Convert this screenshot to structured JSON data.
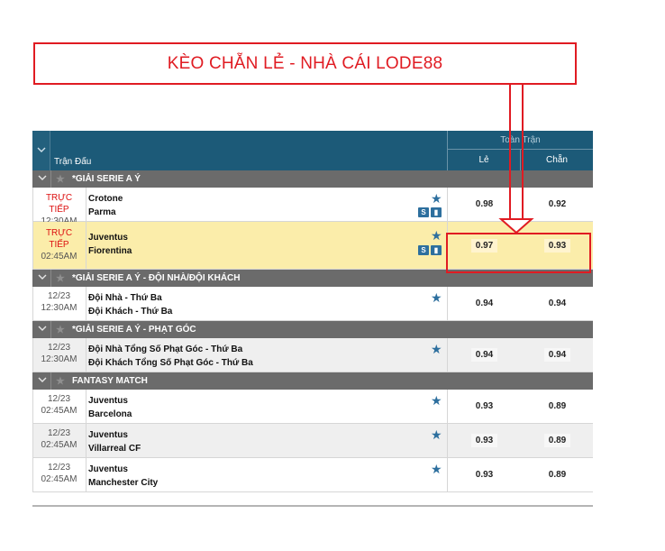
{
  "banner": {
    "title": "KÈO CHẴN LẺ - NHÀ CÁI LODE88",
    "color": "#e01b22"
  },
  "header": {
    "match_label": "Trận Đấu",
    "group_label": "Toàn Trận",
    "col_le": "Lẻ",
    "col_chan": "Chẵn"
  },
  "leagues": [
    {
      "name": "*GIẢI SERIE A Ý"
    },
    {
      "name": "*GIẢI SERIE A Ý - ĐỘI NHÀ/ĐỘI KHÁCH"
    },
    {
      "name": "*GIẢI SERIE A Ý - PHẠT GÓC"
    },
    {
      "name": "FANTASY MATCH"
    }
  ],
  "matches": [
    {
      "time1": "TRỰC",
      "time2": "TIẾP",
      "time3": "12:30AM",
      "home": "Crotone",
      "away": "Parma",
      "le": "0.98",
      "chan": "0.92"
    },
    {
      "time1": "TRỰC",
      "time2": "TIẾP",
      "time3": "02:45AM",
      "home": "Juventus",
      "away": "Fiorentina",
      "le": "0.97",
      "chan": "0.93"
    },
    {
      "time1": "12/23",
      "time3": "12:30AM",
      "home": "Đội Nhà - Thứ Ba",
      "away": "Đội Khách - Thứ Ba",
      "le": "0.94",
      "chan": "0.94"
    },
    {
      "time1": "12/23",
      "time3": "12:30AM",
      "home": "Đội Nhà Tổng Số Phạt Góc - Thứ Ba",
      "away": "Đội Khách Tổng Số Phạt Góc - Thứ Ba",
      "le": "0.94",
      "chan": "0.94"
    },
    {
      "time1": "12/23",
      "time3": "02:45AM",
      "home": "Juventus",
      "away": "Barcelona",
      "le": "0.93",
      "chan": "0.89"
    },
    {
      "time1": "12/23",
      "time3": "02:45AM",
      "home": "Juventus",
      "away": "Villarreal CF",
      "le": "0.93",
      "chan": "0.89"
    },
    {
      "time1": "12/23",
      "time3": "02:45AM",
      "home": "Juventus",
      "away": "Manchester City",
      "le": "0.93",
      "chan": "0.89"
    }
  ],
  "icons": {
    "favorite": "star-icon",
    "stats": "stats-icon",
    "live_tv": "s-icon",
    "collapse": "chevron-down-icon"
  },
  "colors": {
    "header_bg": "#1c5a78",
    "league_bg": "#6b6b6b",
    "highlight_row": "#fbedaa",
    "live_text": "#d11111",
    "star": "#2d6f9e"
  }
}
